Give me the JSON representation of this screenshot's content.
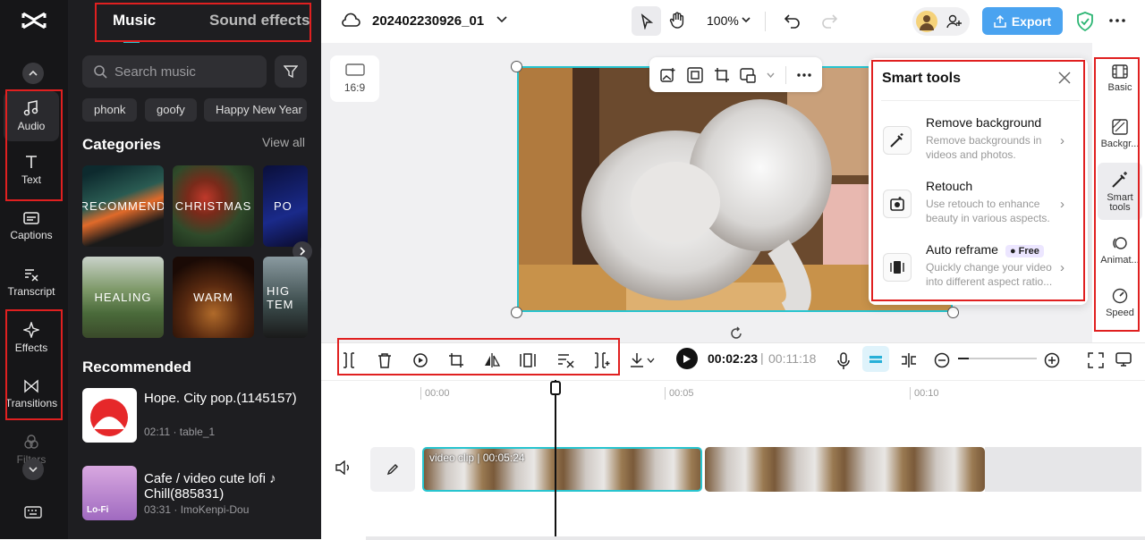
{
  "sidebar": {
    "items": [
      {
        "label": "Audio"
      },
      {
        "label": "Text"
      },
      {
        "label": "Captions"
      },
      {
        "label": "Transcript"
      },
      {
        "label": "Effects"
      },
      {
        "label": "Transitions"
      },
      {
        "label": "Filters"
      }
    ]
  },
  "panel": {
    "tabs": [
      "Music",
      "Sound effects"
    ],
    "search_placeholder": "Search music",
    "chips": [
      "phonk",
      "goofy",
      "Happy New Year"
    ],
    "categories_title": "Categories",
    "view_all": "View all",
    "categories": [
      "RECOMMEND",
      "CHRISTMAS",
      "PO",
      "HEALING",
      "WARM",
      "HIG TEM"
    ],
    "recommended_title": "Recommended",
    "tracks": [
      {
        "title": "Hope. City pop.(1145157)",
        "meta": "02:11 · table_1"
      },
      {
        "title": "Cafe / video cute lofi ♪ Chill(885831)",
        "meta": "03:31 · ImoKenpi-Dou",
        "art_label": "Lo-Fi"
      }
    ]
  },
  "topbar": {
    "project_name": "202402230926_01",
    "zoom": "100%",
    "export_label": "Export"
  },
  "stage": {
    "ratio": "16:9"
  },
  "smart_tools": {
    "title": "Smart tools",
    "tools": [
      {
        "name": "Remove background",
        "desc": "Remove backgrounds in videos and photos."
      },
      {
        "name": "Retouch",
        "desc": "Use retouch to enhance beauty in various aspects."
      },
      {
        "name": "Auto reframe",
        "badge": "Free",
        "desc": "Quickly change your video into different aspect ratio..."
      }
    ]
  },
  "right_rail": {
    "items": [
      "Basic",
      "Backgr...",
      "Smart tools",
      "Animat...",
      "Speed"
    ]
  },
  "playback": {
    "current": "00:02:23",
    "total": "00:11:18"
  },
  "timeline": {
    "ticks": [
      "00:00",
      "00:05",
      "00:10"
    ],
    "clip_label": "video clip",
    "clip_duration": "00:05:24"
  },
  "colors": {
    "accent": "#4aa3f0",
    "selection": "#27c4cf",
    "annotation": "#e02020"
  }
}
